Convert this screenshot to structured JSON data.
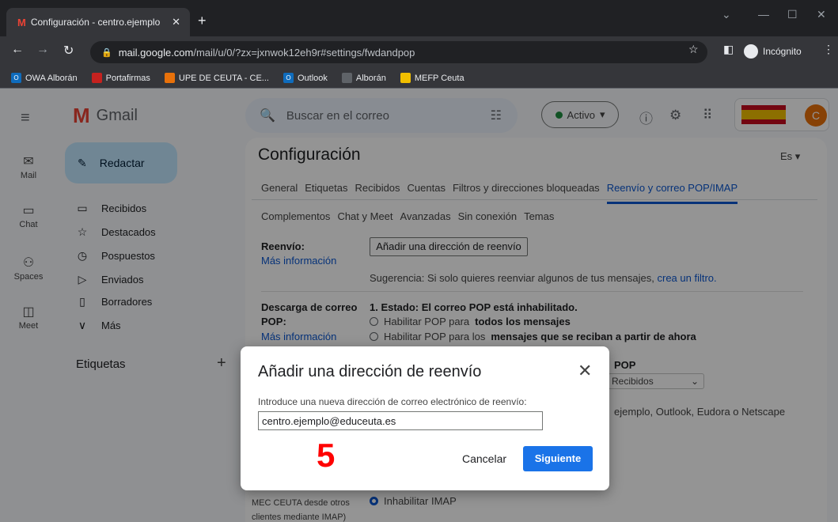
{
  "browser": {
    "tab_title": "Configuración - centro.ejemplo",
    "url_domain": "mail.google.com",
    "url_path": "/mail/u/0/?zx=jxnwok12eh9r#settings/fwdandpop",
    "incognito_label": "Incógnito",
    "bookmarks": [
      "OWA Alborán",
      "Portafirmas",
      "UPE DE CEUTA - CE...",
      "Outlook",
      "Alborán",
      "MEFP Ceuta"
    ]
  },
  "gmail": {
    "app_name": "Gmail",
    "search_placeholder": "Buscar en el correo",
    "status_label": "Activo",
    "avatar_initial": "C",
    "rail": [
      "Mail",
      "Chat",
      "Spaces",
      "Meet"
    ],
    "compose_label": "Redactar",
    "nav": [
      "Recibidos",
      "Destacados",
      "Pospuestos",
      "Enviados",
      "Borradores",
      "Más"
    ],
    "labels_heading": "Etiquetas"
  },
  "settings": {
    "title": "Configuración",
    "lang": "Es",
    "tabs_row1": [
      "General",
      "Etiquetas",
      "Recibidos",
      "Cuentas",
      "Filtros y direcciones bloqueadas",
      "Reenvío y correo POP/IMAP"
    ],
    "tabs_row2": [
      "Complementos",
      "Chat y Meet",
      "Avanzadas",
      "Sin conexión",
      "Temas"
    ],
    "forward_label": "Reenvío:",
    "more_info": "Más información",
    "add_forward_button": "Añadir una dirección de reenvío",
    "hint_text": "Sugerencia: Si solo quieres reenviar algunos de tus mensajes, ",
    "hint_link": "crea un filtro.",
    "pop_label_1": "Descarga de correo",
    "pop_label_2": "POP:",
    "pop_status": "1. Estado: El correo POP está inhabilitado.",
    "pop_opt1_pre": "Habilitar POP para ",
    "pop_opt1_bold": "todos los mensajes",
    "pop_opt2_pre": "Habilitar POP para los ",
    "pop_opt2_bold": "mensajes que se reciban a partir de ahora",
    "pop_fragment": "POP",
    "pop_select": "Recibidos",
    "clients_fragment": "ejemplo, Outlook, Eudora o Netscape",
    "imap_label_1": "MEC CEUTA desde otros",
    "imap_label_2": "clientes mediante IMAP)",
    "imap_option": "Inhabilitar IMAP"
  },
  "dialog": {
    "title": "Añadir una dirección de reenvío",
    "prompt": "Introduce una nueva dirección de correo electrónico de reenvío:",
    "input_value": "centro.ejemplo@educeuta.es",
    "step_annotation": "5",
    "cancel_label": "Cancelar",
    "next_label": "Siguiente"
  }
}
